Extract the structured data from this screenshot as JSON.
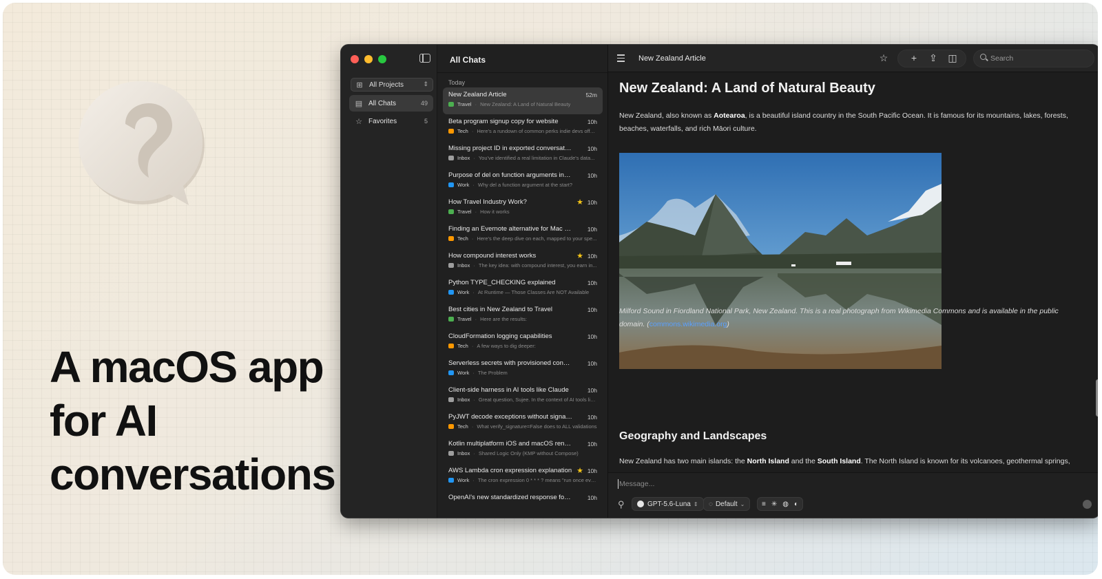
{
  "hero": {
    "line1": "A macOS app",
    "line2": "for AI",
    "line3": "conversations"
  },
  "colors": {
    "traffic_red": "#ff5f57",
    "traffic_yellow": "#febc2e",
    "traffic_green": "#28c840",
    "link": "#5aa0ff",
    "star": "#f5c518"
  },
  "sidebar": {
    "project_selector": "All Projects",
    "items": [
      {
        "label": "All Chats",
        "count": "49",
        "icon": "inbox-icon"
      },
      {
        "label": "Favorites",
        "count": "5",
        "icon": "star-icon"
      }
    ]
  },
  "list": {
    "title": "All Chats",
    "section": "Today",
    "rows": [
      {
        "title": "New Zealand Article",
        "time": "52m",
        "project": "Travel",
        "preview": "New Zealand: A Land of Natural Beauty",
        "star": false,
        "color": "#4caf50"
      },
      {
        "title": "Beta program signup copy for website",
        "time": "10h",
        "project": "Tech",
        "preview": "Here's a rundown of common perks indie devs offe...",
        "star": false,
        "color": "#ff9800"
      },
      {
        "title": "Missing project ID in exported conversations",
        "time": "10h",
        "project": "Inbox",
        "preview": "You've identified a real limitation in Claude's data...",
        "star": false,
        "color": "#9e9e9e"
      },
      {
        "title": "Purpose of del on function arguments in Python",
        "time": "10h",
        "project": "Work",
        "preview": "Why del a function argument at the start?",
        "star": false,
        "color": "#2196f3"
      },
      {
        "title": "How Travel Industry Work?",
        "time": "10h",
        "project": "Travel",
        "preview": "How it works",
        "star": true,
        "color": "#4caf50"
      },
      {
        "title": "Finding an Evernote alternative for Mac and iOS",
        "time": "10h",
        "project": "Tech",
        "preview": "Here's the deep dive on each, mapped to your spe...",
        "star": false,
        "color": "#ff9800"
      },
      {
        "title": "How compound interest works",
        "time": "10h",
        "project": "Inbox",
        "preview": "The key idea: with compound interest, you earn in...",
        "star": true,
        "color": "#9e9e9e"
      },
      {
        "title": "Python TYPE_CHECKING explained",
        "time": "10h",
        "project": "Work",
        "preview": "At Runtime — Those Classes Are NOT Available",
        "star": false,
        "color": "#2196f3"
      },
      {
        "title": "Best cities in New Zealand to Travel",
        "time": "10h",
        "project": "Travel",
        "preview": "Here are the results:",
        "star": false,
        "color": "#4caf50"
      },
      {
        "title": "CloudFormation logging capabilities",
        "time": "10h",
        "project": "Tech",
        "preview": "A few ways to dig deeper:",
        "star": false,
        "color": "#ff9800"
      },
      {
        "title": "Serverless secrets with provisioned concurren...",
        "time": "10h",
        "project": "Work",
        "preview": "The Problem",
        "star": false,
        "color": "#2196f3"
      },
      {
        "title": "Client-side harness in AI tools like Claude",
        "time": "10h",
        "project": "Inbox",
        "preview": "Great question, Sujee. In the context of AI tools lik...",
        "star": false,
        "color": "#9e9e9e"
      },
      {
        "title": "PyJWT decode exceptions without signature v...",
        "time": "10h",
        "project": "Tech",
        "preview": "What verify_signature=False does to ALL validations",
        "star": false,
        "color": "#ff9800"
      },
      {
        "title": "Kotlin multiplatform iOS and macOS rendering",
        "time": "10h",
        "project": "Inbox",
        "preview": "Shared Logic Only (KMP without Compose)",
        "star": false,
        "color": "#9e9e9e"
      },
      {
        "title": "AWS Lambda cron expression explanation",
        "time": "10h",
        "project": "Work",
        "preview": "The cron expression 0 * * * ? means \"run once eve...",
        "star": true,
        "color": "#2196f3"
      },
      {
        "title": "OpenAI's new standardized response format",
        "time": "10h",
        "project": "",
        "preview": "",
        "star": false,
        "color": "#9e9e9e"
      }
    ]
  },
  "toolbar": {
    "title": "New Zealand Article",
    "search_placeholder": "Search"
  },
  "doc": {
    "title": "New Zealand: A Land of Natural Beauty",
    "intro_a": "New Zealand, also known as ",
    "intro_b": "Aotearoa",
    "intro_c": ", is a beautiful island country in the South Pacific Ocean. It is famous for its mountains, lakes, forests, beaches, waterfalls, and rich Māori culture.",
    "caption": "Milford Sound in Fiordland National Park, New Zealand. This is a real photograph from Wikimedia Commons and is available in the public domain.",
    "caption_open": " (",
    "caption_link": "commons.wikimedia.org",
    "caption_close": ")",
    "h2": "Geography and Landscapes",
    "geo_a": "New Zealand has two main islands: the ",
    "geo_b": "North Island",
    "geo_c": " and the ",
    "geo_d": "South Island",
    "geo_e": ". The North Island is known for its volcanoes, geothermal springs,"
  },
  "composer": {
    "placeholder": "Message...",
    "model": "GPT-5.6-Luna",
    "mode": "Default"
  }
}
